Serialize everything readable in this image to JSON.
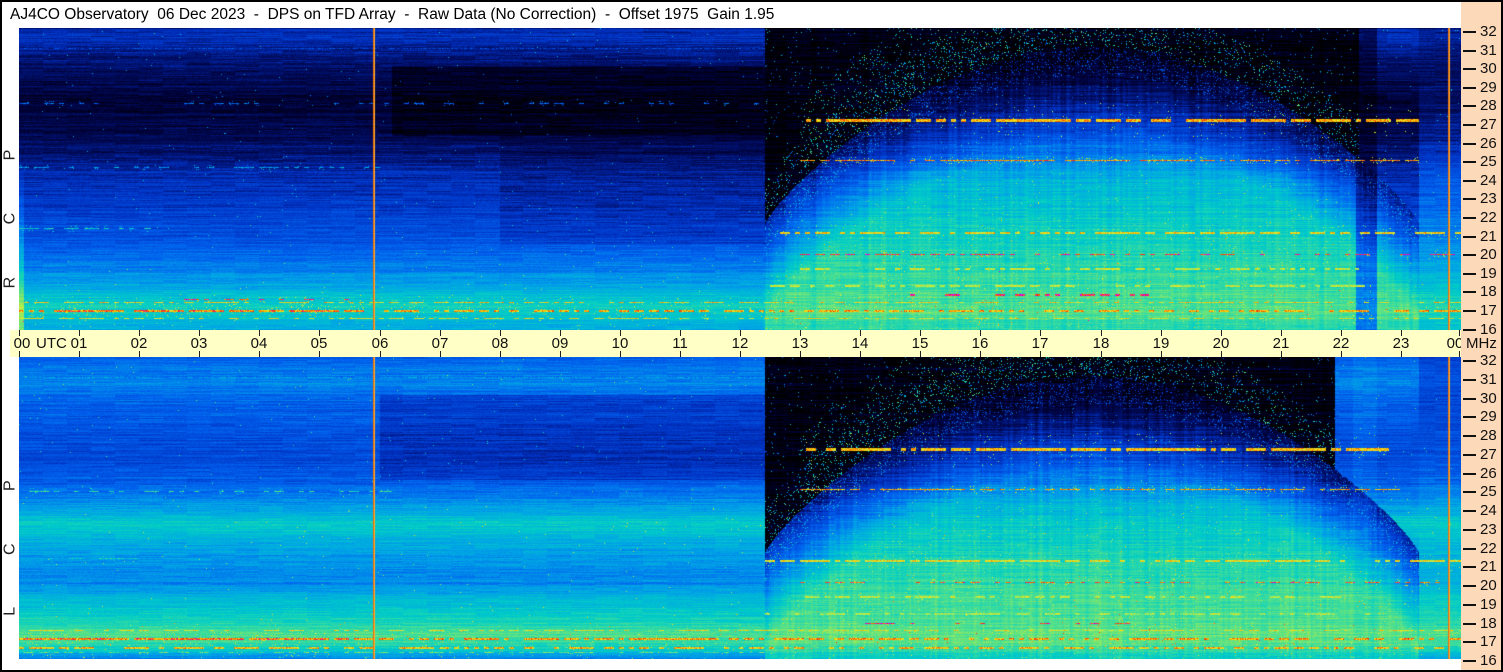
{
  "title": "AJ4CO Observatory  06 Dec 2023  -  DPS on TFD Array  -  Raw Data (No Correction)  -  Offset 1975  Gain 1.95",
  "panel_labels": {
    "rcp": "R C P",
    "lcp": "L C P"
  },
  "axis_units": {
    "time": "UTC",
    "frequency": "MHz"
  },
  "colors": {
    "background": "#ffffff",
    "border": "#000000",
    "right_margin": "#fcd9b9",
    "time_axis_band": "#ffffc6",
    "title_text": "#000000",
    "axis_text": "#111111",
    "calibration_line": "#ffac28"
  },
  "chart_data": {
    "type": "heatmap",
    "title": "AJ4CO Observatory  06 Dec 2023  -  DPS on TFD Array  -  Raw Data (No Correction)  -  Offset 1975  Gain 1.95",
    "observation_date": "06 Dec 2023",
    "instrument": "DPS on TFD Array",
    "data_state": "Raw Data (No Correction)",
    "offset": 1975,
    "gain": 1.95,
    "grid": false,
    "legend": false,
    "x_axis": {
      "label": "UTC",
      "min_hours": 0,
      "max_hours": 24,
      "tick_interval_hours": 1,
      "tick_labels": [
        "00",
        "01",
        "02",
        "03",
        "04",
        "05",
        "06",
        "07",
        "08",
        "09",
        "10",
        "11",
        "12",
        "13",
        "14",
        "15",
        "16",
        "17",
        "18",
        "19",
        "20",
        "21",
        "22",
        "23",
        "00"
      ]
    },
    "y_axis": {
      "label": "MHz",
      "min_mhz": 16,
      "max_mhz": 32,
      "tick_interval_mhz": 1,
      "tick_labels": [
        32,
        31,
        30,
        29,
        28,
        27,
        26,
        25,
        24,
        23,
        22,
        21,
        20,
        19,
        18,
        17,
        16
      ]
    },
    "colormap": [
      [
        0.0,
        "#000000"
      ],
      [
        0.06,
        "#000030"
      ],
      [
        0.13,
        "#00106a"
      ],
      [
        0.2,
        "#0030c0"
      ],
      [
        0.3,
        "#0060ee"
      ],
      [
        0.4,
        "#00a0e8"
      ],
      [
        0.5,
        "#00ccc8"
      ],
      [
        0.58,
        "#3cdc9c"
      ],
      [
        0.66,
        "#86e868"
      ],
      [
        0.74,
        "#d2ee3c"
      ],
      [
        0.82,
        "#ffd800"
      ],
      [
        0.89,
        "#ff8000"
      ],
      [
        0.95,
        "#ff2a00"
      ],
      [
        1.0,
        "#f000d0"
      ]
    ],
    "calibration_markers": {
      "times_utc": [
        5.9,
        23.78
      ],
      "colors": [
        "#e86f10",
        "#ffac28"
      ]
    },
    "day_transition_utc": 12.42,
    "panels": [
      {
        "name": "RCP",
        "polarization_label": "R C P",
        "render": {
          "seed": 20231206,
          "night_end": 12.42,
          "day_top_end": 22.3,
          "day_end": 23.3,
          "cut_base": 21.6,
          "cut_amp": 9.4,
          "cut_pow": 0.8,
          "edge_boost": true,
          "night_stops": [
            [
              32,
              0.17
            ],
            [
              31.5,
              0.2
            ],
            [
              30.5,
              0.15
            ],
            [
              29.5,
              0.11
            ],
            [
              28.3,
              0.07
            ],
            [
              27.2,
              0.08
            ],
            [
              26,
              0.11
            ],
            [
              25,
              0.15
            ],
            [
              24.5,
              0.18
            ],
            [
              23,
              0.21
            ],
            [
              21,
              0.27
            ],
            [
              20,
              0.31
            ],
            [
              19,
              0.37
            ],
            [
              18,
              0.45
            ],
            [
              17.3,
              0.52
            ],
            [
              16.6,
              0.47
            ],
            [
              16,
              0.43
            ]
          ],
          "day_stops": [
            [
              32,
              0.1
            ],
            [
              30,
              0.12
            ],
            [
              29,
              0.16
            ],
            [
              28,
              0.22
            ],
            [
              27,
              0.26
            ],
            [
              26,
              0.3
            ],
            [
              25,
              0.36
            ],
            [
              24,
              0.44
            ],
            [
              23,
              0.47
            ],
            [
              22,
              0.5
            ],
            [
              21,
              0.52
            ],
            [
              20,
              0.54
            ],
            [
              19,
              0.56
            ],
            [
              18,
              0.58
            ],
            [
              17,
              0.6
            ],
            [
              16,
              0.55
            ]
          ],
          "dim_zones": [
            {
              "t0": 6.2,
              "t1": 12.42,
              "f0": 26.3,
              "f1": 30.0,
              "factor": 0.45
            },
            {
              "t0": 8.0,
              "t1": 12.42,
              "f0": 20.5,
              "f1": 26.3,
              "factor": 0.85
            }
          ],
          "band_22utc": {
            "t0": 22.25,
            "t1": 22.6,
            "mul": 0.6,
            "add": 0
          },
          "rfi_lines": [
            [
              27.1,
              13.1,
              23.3,
              0.84,
              3,
              0.85,
              0.9
            ],
            [
              25.0,
              13.0,
              23.3,
              0.87,
              1,
              0.8,
              0.15
            ],
            [
              21.15,
              12.42,
              24.0,
              0.8,
              2,
              0.7,
              0.3
            ],
            [
              20.0,
              13.0,
              23.9,
              0.97,
              1,
              0.45,
              0.15
            ],
            [
              19.25,
              13.0,
              22.3,
              0.74,
              2,
              0.5,
              0.45
            ],
            [
              18.35,
              12.42,
              22.5,
              0.72,
              2,
              0.55,
              0.4
            ],
            [
              17.85,
              14.5,
              18.8,
              0.98,
              2,
              0.45,
              0.25
            ],
            [
              17.45,
              0,
              24.0,
              0.8,
              1,
              0.55,
              0.3
            ],
            [
              17.0,
              0,
              24.0,
              0.85,
              2,
              0.6,
              0.4
            ],
            [
              17.0,
              0,
              5.8,
              0.9,
              2,
              0.75,
              0.3
            ],
            [
              16.6,
              0,
              24.0,
              0.78,
              1,
              0.5,
              0.5
            ],
            [
              30.9,
              0,
              12.42,
              0.22,
              1,
              0.9,
              0
            ],
            [
              28.0,
              0,
              12.42,
              0.3,
              1,
              0.3,
              0.1
            ],
            [
              24.6,
              0,
              6.0,
              0.4,
              1,
              0.35,
              0.1
            ],
            [
              21.4,
              0,
              2.2,
              0.5,
              1,
              0.45,
              0.15
            ],
            [
              17.6,
              2.5,
              5.5,
              0.95,
              1,
              0.3,
              0.1
            ]
          ]
        }
      },
      {
        "name": "LCP",
        "polarization_label": "L C P",
        "render": {
          "seed": 6122023,
          "night_end": 12.42,
          "day_top_end": 21.9,
          "day_end": 23.3,
          "cut_base": 21.6,
          "cut_amp": 9.4,
          "cut_pow": 0.8,
          "edge_boost": false,
          "night_stops": [
            [
              32,
              0.3
            ],
            [
              30.7,
              0.36
            ],
            [
              29.5,
              0.3
            ],
            [
              28,
              0.27
            ],
            [
              27,
              0.25
            ],
            [
              26,
              0.27
            ],
            [
              25,
              0.31
            ],
            [
              24,
              0.4
            ],
            [
              23.2,
              0.5
            ],
            [
              22.3,
              0.44
            ],
            [
              21,
              0.37
            ],
            [
              20,
              0.36
            ],
            [
              19,
              0.46
            ],
            [
              18,
              0.53
            ],
            [
              17.2,
              0.6
            ],
            [
              16.5,
              0.5
            ],
            [
              16,
              0.34
            ]
          ],
          "day_stops": [
            [
              32,
              0.1
            ],
            [
              30,
              0.13
            ],
            [
              29,
              0.17
            ],
            [
              28,
              0.24
            ],
            [
              27,
              0.28
            ],
            [
              26,
              0.32
            ],
            [
              25,
              0.38
            ],
            [
              24,
              0.46
            ],
            [
              23,
              0.5
            ],
            [
              22,
              0.52
            ],
            [
              21,
              0.54
            ],
            [
              20,
              0.56
            ],
            [
              19,
              0.58
            ],
            [
              18,
              0.6
            ],
            [
              17,
              0.62
            ],
            [
              16,
              0.5
            ]
          ],
          "dim_zones": [
            {
              "t0": 6.0,
              "t1": 12.42,
              "f0": 25.5,
              "f1": 30.0,
              "factor": 0.78
            }
          ],
          "band_22utc": {
            "t0": 22.2,
            "t1": 22.6,
            "mul": 0.85,
            "add": 0.07
          },
          "rfi_lines": [
            [
              27.1,
              13.1,
              22.8,
              0.82,
              3,
              0.8,
              0.8
            ],
            [
              25.0,
              13.0,
              23.3,
              0.85,
              1,
              0.75,
              0.15
            ],
            [
              21.2,
              12.42,
              24.0,
              0.78,
              2,
              0.65,
              0.35
            ],
            [
              20.05,
              13.0,
              23.9,
              0.92,
              1,
              0.45,
              0.15
            ],
            [
              19.3,
              13.0,
              22.0,
              0.72,
              2,
              0.5,
              0.45
            ],
            [
              18.4,
              12.42,
              22.5,
              0.7,
              2,
              0.55,
              0.4
            ],
            [
              17.9,
              13.5,
              18.5,
              0.97,
              1,
              0.4,
              0.2
            ],
            [
              17.5,
              0,
              24.0,
              0.78,
              1,
              0.55,
              0.3
            ],
            [
              17.05,
              0,
              24.0,
              0.86,
              2,
              0.65,
              0.4
            ],
            [
              17.05,
              0,
              5.8,
              0.9,
              2,
              0.75,
              0.3
            ],
            [
              16.6,
              0,
              24.0,
              0.83,
              2,
              0.55,
              0.5
            ],
            [
              16.35,
              0,
              12.42,
              0.62,
              1,
              0.5,
              0.3
            ],
            [
              30.9,
              0,
              12.42,
              0.38,
              1,
              0.9,
              0
            ],
            [
              24.9,
              0,
              6.2,
              0.55,
              1,
              0.4,
              0.15
            ],
            [
              21.3,
              0,
              2.0,
              0.5,
              1,
              0.4,
              0.15
            ]
          ]
        }
      }
    ]
  }
}
